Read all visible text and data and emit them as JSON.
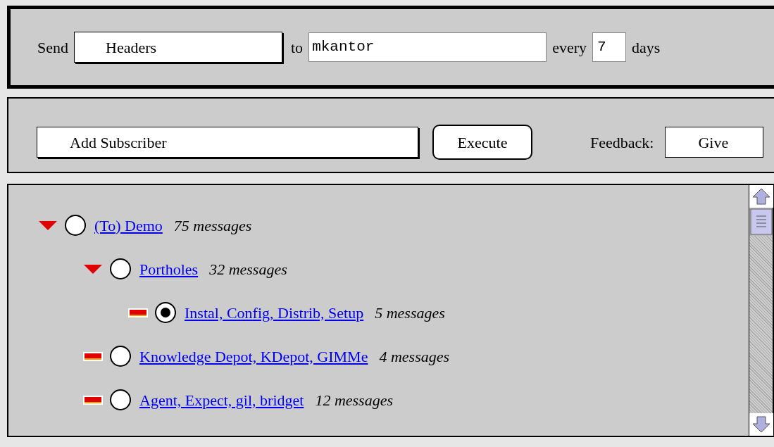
{
  "send_bar": {
    "send_label": "Send",
    "send_what": "Headers",
    "to_label": "to",
    "recipient": "mkantor",
    "every_label": "every",
    "interval": "7",
    "days_label": "days"
  },
  "action_bar": {
    "action": "Add Subscriber",
    "execute_button": "Execute",
    "feedback_label": "Feedback:",
    "feedback_choice": "Give"
  },
  "tree": [
    {
      "title": "(To) Demo",
      "count": "75 messages",
      "expanded": true,
      "selected": false,
      "children": [
        {
          "title": "Portholes",
          "count": "32 messages",
          "expanded": true,
          "selected": false,
          "children": [
            {
              "title": "Instal, Config, Distrib, Setup",
              "count": "5 messages",
              "expanded": false,
              "selected": true
            }
          ]
        },
        {
          "title": "Knowledge Depot, KDepot, GIMMe",
          "count": "4 messages",
          "expanded": false,
          "selected": false
        },
        {
          "title": "Agent, Expect, gil, bridget",
          "count": "12 messages",
          "expanded": false,
          "selected": false
        }
      ]
    }
  ]
}
